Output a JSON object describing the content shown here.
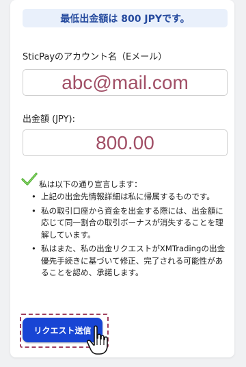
{
  "banner": {
    "text": "最低出金額は 800 JPYです。"
  },
  "account": {
    "label": "SticPayのアカウント名（Eメール）",
    "value": "abc@mail.com"
  },
  "amount": {
    "label": "出金額 (JPY):",
    "value": "800.00"
  },
  "declaration": {
    "intro": "私は以下の通り宣言します：",
    "items": [
      "上記の出金先情報詳細は私に帰属するものです。",
      "私の取引口座から資金を出金する際には、出金額に応じて同一割合の取引ボーナスが消失することを理解しています。",
      "私はまた、私の出金リクエストがXMTradingの出金優先手続きに基づいて修正、完了される可能性があることを認め、承諾します。"
    ]
  },
  "submit": {
    "label": "リクエスト送信"
  },
  "colors": {
    "accent": "#1845d4",
    "value_text": "#a14f66",
    "banner_bg": "#e9f0fb",
    "highlight": "#a04060",
    "check": "#4cae2e"
  },
  "icons": {
    "check": "checkmark-icon",
    "cursor": "hand-pointer-icon"
  }
}
